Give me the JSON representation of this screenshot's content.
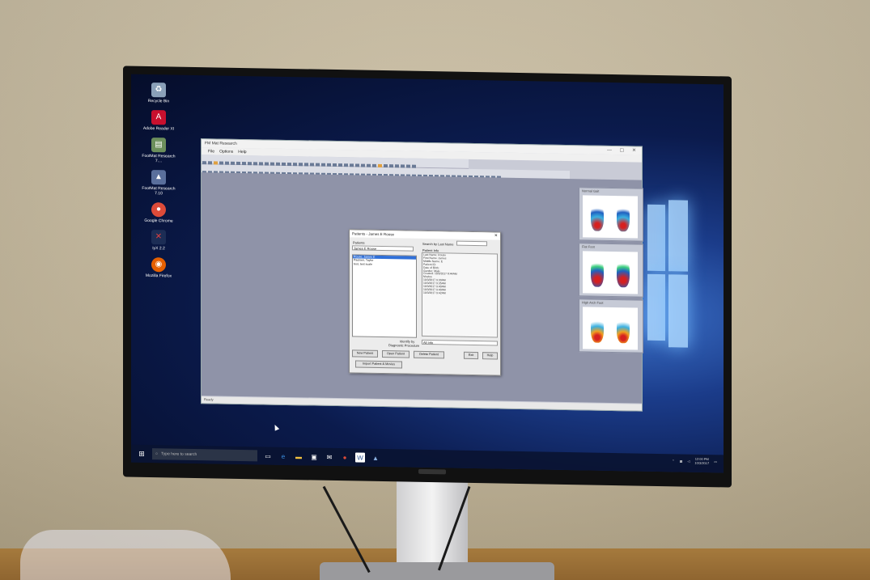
{
  "desktop_icons": [
    {
      "label": "Recycle Bin",
      "icon": "recycle-bin-icon",
      "color": "#8aa0b8"
    },
    {
      "label": "Adobe Reader XI",
      "icon": "pdf-icon",
      "color": "#c8102e"
    },
    {
      "label": "FootMat Research 7....",
      "icon": "file-shortcut-icon",
      "color": "#6c8f5c"
    },
    {
      "label": "FootMat Research 7.10",
      "icon": "app-shortcut-icon",
      "color": "#5a6f9c"
    },
    {
      "label": "Google Chrome",
      "icon": "chrome-icon",
      "color": "#dd4b39"
    },
    {
      "label": "IyX 2.2",
      "icon": "lyx-icon",
      "color": "#c0392b"
    },
    {
      "label": "Mozilla Firefox",
      "icon": "firefox-icon",
      "color": "#e66000"
    }
  ],
  "app": {
    "title": "FM Mat Research",
    "menu": [
      "File",
      "Options",
      "Help"
    ],
    "status": "Ready"
  },
  "dialog": {
    "title": "Patients - James E Rouse",
    "patients_label": "Patients",
    "patient_field_value": "James E Rouse",
    "search_label": "Search by Last Name",
    "search_value": "",
    "patient_info_label": "Patient Info",
    "patients": [
      "Rouse, James E",
      "Paulsen, Taylor",
      "test, test scale"
    ],
    "info_lines": [
      "Last Name: Rouse",
      "First Name: James",
      "Middle Name: E",
      "Patient ID:",
      "Date of Birth:",
      "Gender: Male",
      "Created: 10/3/2017 8:44AM",
      "",
      "Movies",
      "10/3/2017 9:30AM",
      "10/3/2017 9:35AM",
      "10/3/2017 9:40AM",
      "10/3/2017 9:40AM",
      "10/3/2017 9:42AM"
    ],
    "identify_label": "Identify by",
    "diagnostic_label": "Diagnostic Procedure",
    "identify_value": "All Info",
    "buttons": {
      "new_patient": "New Patient",
      "open_patient": "Open Patient",
      "delete_patient": "Delete Patient",
      "exit": "Exit",
      "help": "Help",
      "import": "Import Patient & Movies"
    }
  },
  "side_panels": [
    {
      "caption": "Normal Gait"
    },
    {
      "caption": "Flat Foot"
    },
    {
      "caption": "High Arch Foot"
    }
  ],
  "taskbar": {
    "search_placeholder": "Type here to search",
    "clock_time": "12:00 PM",
    "clock_date": "10/3/2017"
  }
}
